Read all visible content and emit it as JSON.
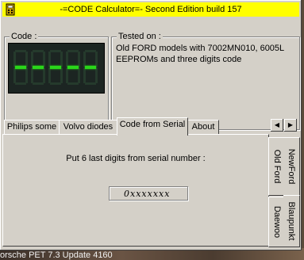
{
  "window": {
    "title": "-=CODE Calculator=-  Second Edition   build 157",
    "titlebar_color": "#ffff00"
  },
  "code_group": {
    "label": "Code :",
    "display_value": "-----",
    "lcd_color": "#2ad51a"
  },
  "tested_group": {
    "label": "Tested on :",
    "text_lines": [
      "Old FORD models with 7002MN010, 6005L",
      "EEPROMs and three digits code"
    ]
  },
  "tabs": [
    {
      "label": "Philips some",
      "active": false
    },
    {
      "label": "Volvo diodes",
      "active": false
    },
    {
      "label": "Code from Serial",
      "active": true
    },
    {
      "label": "About",
      "active": false
    }
  ],
  "tab_scroll": {
    "left_icon": "arrow-left-icon",
    "right_icon": "arrow-right-icon"
  },
  "page": {
    "prompt": "Put 6 last digits from serial number :",
    "serial_value": "0xxxxxxx"
  },
  "side_tabs": [
    {
      "label": "Old Ford",
      "active": true
    },
    {
      "label": "NewFord",
      "active": false
    },
    {
      "label": "Blaupunkt",
      "active": false
    },
    {
      "label": "Daewoo",
      "active": false
    }
  ],
  "background_app": {
    "text": "orsche PET 7.3 Update 4160"
  }
}
